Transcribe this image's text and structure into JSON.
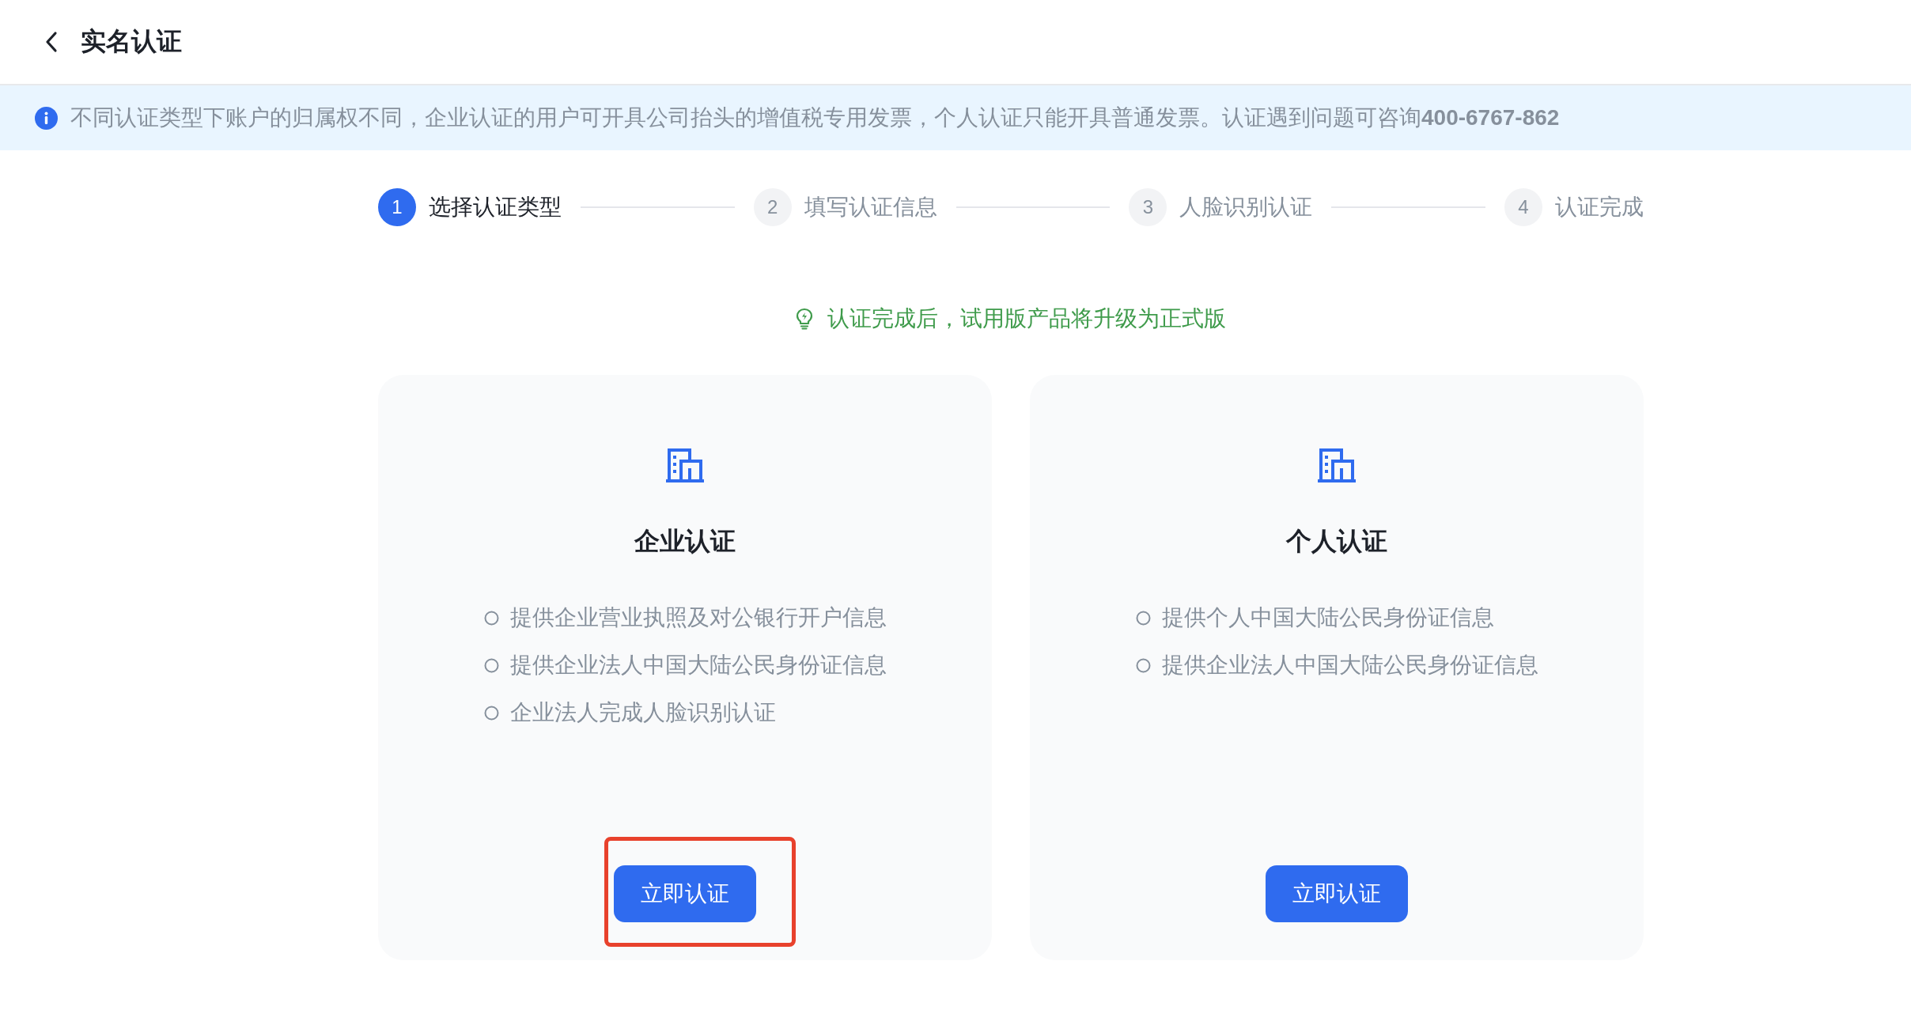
{
  "header": {
    "title": "实名认证"
  },
  "notice": {
    "text": "不同认证类型下账户的归属权不同，企业认证的用户可开具公司抬头的增值税专用发票，个人认证只能开具普通发票。认证遇到问题可咨询**400-6767-862**"
  },
  "steps": [
    {
      "number": "1",
      "label": "选择认证类型",
      "selected": true
    },
    {
      "number": "2",
      "label": "填写认证信息",
      "selected": false
    },
    {
      "number": "3",
      "label": "人脸识别认证",
      "selected": false
    },
    {
      "number": "4",
      "label": "认证完成",
      "selected": false
    }
  ],
  "tip": {
    "text": "认证完成后，试用版产品将升级为正式版"
  },
  "cards": [
    {
      "title": "企业认证",
      "items": [
        "提供企业营业执照及对公银行开户信息",
        "提供企业法人中国大陆公民身份证信息",
        "企业法人完成人脸识别认证"
      ],
      "button": "立即认证",
      "highlighted": true
    },
    {
      "title": "个人认证",
      "items": [
        "提供个人中国大陆公民身份证信息",
        "提供企业法人中国大陆公民身份证信息"
      ],
      "button": "立即认证",
      "highlighted": false
    }
  ]
}
